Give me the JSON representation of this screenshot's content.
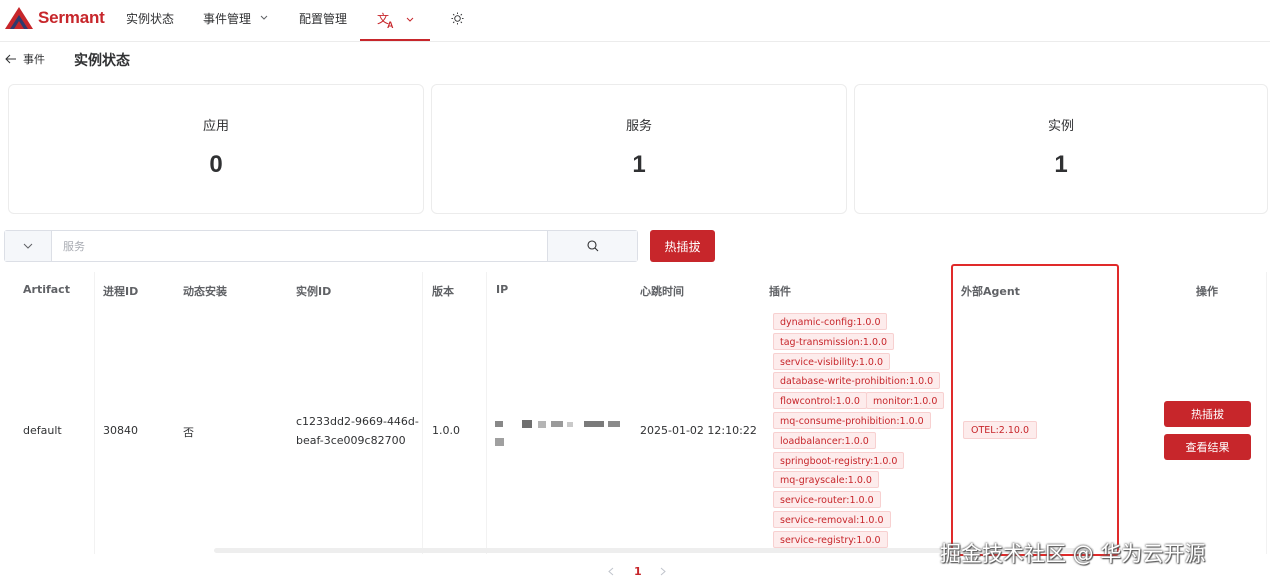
{
  "app": {
    "logo_text": "Sermant",
    "brand_color": "#c7262b"
  },
  "nav": {
    "items": [
      {
        "label": "实例状态"
      },
      {
        "label": "事件管理"
      },
      {
        "label": "配置管理"
      }
    ],
    "language_icon": "translate-icon",
    "theme_icon": "sun-icon"
  },
  "breadcrumb": {
    "back_label": "事件",
    "title": "实例状态"
  },
  "stats": [
    {
      "label": "应用",
      "value": "0"
    },
    {
      "label": "服务",
      "value": "1"
    },
    {
      "label": "实例",
      "value": "1"
    }
  ],
  "search": {
    "placeholder": "服务",
    "value": ""
  },
  "toolbar": {
    "hot_plug_label": "热插拔"
  },
  "table": {
    "headers": [
      "Artifact",
      "进程ID",
      "动态安装",
      "实例ID",
      "版本",
      "IP",
      "心跳时间",
      "插件",
      "外部Agent",
      "操作"
    ],
    "row": {
      "artifact": "default",
      "pid": "30840",
      "dynamic_install": "否",
      "instance_id_line1": "c1233dd2-9669-446d-",
      "instance_id_line2": "beaf-3ce009c82700",
      "version": "1.0.0",
      "heartbeat": "2025-01-02 12:10:22",
      "plugins": [
        "dynamic-config:1.0.0",
        "tag-transmission:1.0.0",
        "service-visibility:1.0.0",
        "database-write-prohibition:1.0.0",
        "flowcontrol:1.0.0",
        "monitor:1.0.0",
        "mq-consume-prohibition:1.0.0",
        "loadbalancer:1.0.0",
        "springboot-registry:1.0.0",
        "mq-grayscale:1.0.0",
        "service-router:1.0.0",
        "service-removal:1.0.0",
        "service-registry:1.0.0"
      ],
      "external_agent": "OTEL:2.10.0",
      "actions": {
        "hot_plug": "热插拔",
        "view_result": "查看结果"
      }
    }
  },
  "pagination": {
    "current": "1"
  },
  "watermark": "掘金技术社区 @ 华为云开源"
}
